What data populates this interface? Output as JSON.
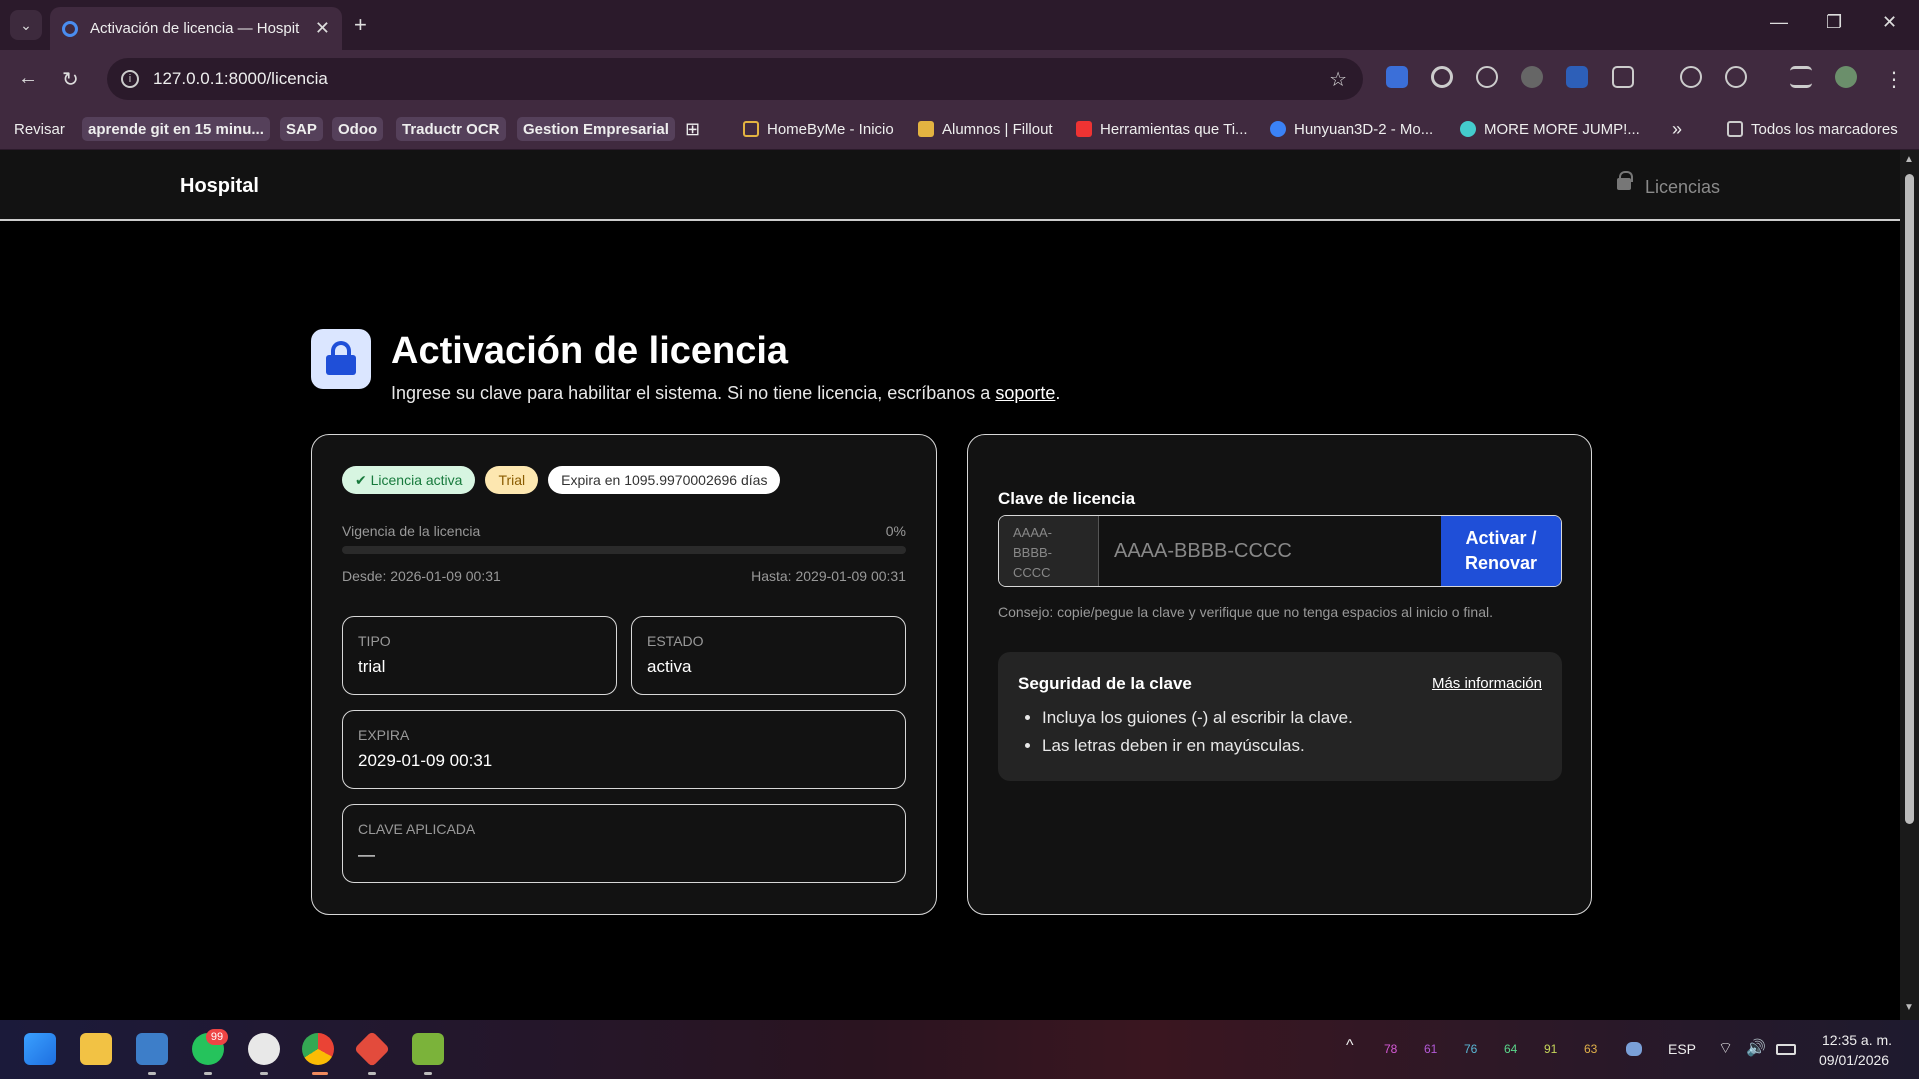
{
  "browser": {
    "tab_title": "Activación de licencia — Hospital",
    "url": "127.0.0.1:8000/licencia",
    "bookmarks": [
      {
        "label": "Revisar",
        "chip": false
      },
      {
        "label": "aprende git en 15 minu...",
        "chip": true
      },
      {
        "label": "SAP",
        "chip": true
      },
      {
        "label": "Odoo",
        "chip": true
      },
      {
        "label": "Traductr OCR",
        "chip": true
      },
      {
        "label": "Gestion Empresarial",
        "chip": true
      },
      {
        "label": "HomeByMe - Inicio",
        "chip": false
      },
      {
        "label": "Alumnos | Fillout",
        "chip": false
      },
      {
        "label": "Herramientas que Ti...",
        "chip": false
      },
      {
        "label": "Hunyuan3D-2 - Mo...",
        "chip": false
      },
      {
        "label": "MORE MORE JUMP!...",
        "chip": false
      }
    ],
    "all_bookmarks": "Todos los marcadores"
  },
  "app": {
    "brand": "Hospital",
    "nav_link": "Licencias"
  },
  "page": {
    "title": "Activación de licencia",
    "subtitle_prefix": "Ingrese su clave para habilitar el sistema. Si no tiene licencia, escríbanos a ",
    "subtitle_link": "soporte",
    "subtitle_suffix": "."
  },
  "status": {
    "badge_active": "✔ Licencia activa",
    "badge_type": "Trial",
    "badge_expires": "Expira en 1095.9970002696 días",
    "progress_label": "Vigencia de la licencia",
    "progress_percent_text": "0%",
    "progress_fraction": 0,
    "since": "Desde: 2026-01-09 00:31",
    "until": "Hasta: 2029-01-09 00:31",
    "fields": {
      "tipo_label": "TIPO",
      "tipo_value": "trial",
      "estado_label": "ESTADO",
      "estado_value": "activa",
      "expira_label": "EXPIRA",
      "expira_value": "2029-01-09 00:31",
      "clave_label": "CLAVE APLICADA",
      "clave_value": "—"
    }
  },
  "activation": {
    "label": "Clave de licencia",
    "addon": "AAAA-BBBB-CCCC",
    "placeholder": "AAAA-BBBB-CCCC",
    "value": "",
    "button": "Activar / Renovar",
    "tip": "Consejo: copie/pegue la clave y verifique que no tenga espacios al inicio o final.",
    "security": {
      "title": "Seguridad de la clave",
      "more": "Más información",
      "items": [
        "Incluya los guiones (-) al escribir la clave.",
        "Las letras deben ir en mayúsculas."
      ]
    }
  },
  "taskbar": {
    "whatsapp_badge": "99",
    "tray_numbers": [
      "78",
      "61",
      "76",
      "64",
      "91",
      "63"
    ],
    "language": "ESP",
    "time": "12:35 a. m.",
    "date": "09/01/2026"
  },
  "colors": {
    "accent": "#1f4fd8",
    "badge_active_bg": "#d7f5e1",
    "badge_trial_bg": "#fde7b0"
  }
}
